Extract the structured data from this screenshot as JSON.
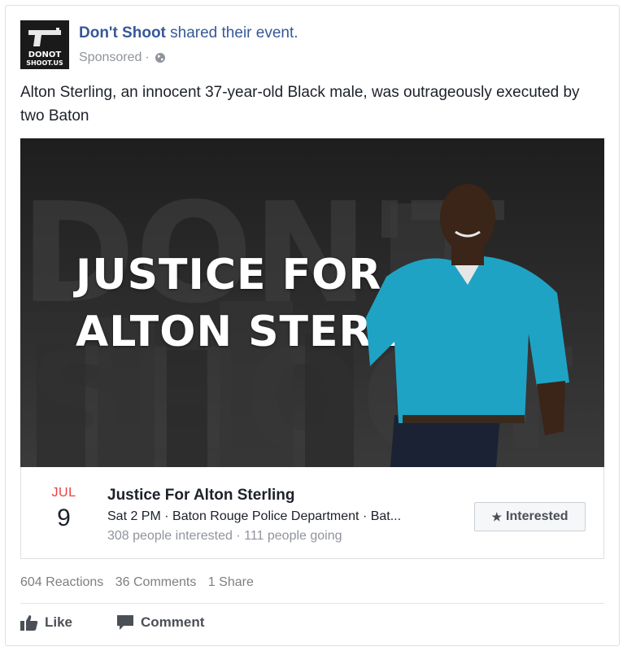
{
  "post": {
    "page_name": "Don't Shoot",
    "shared_text": "shared their event.",
    "sponsored": "Sponsored",
    "dot": "·",
    "avatar_line1": "DONOT",
    "avatar_line2": "SHOOT.US",
    "body": "Alton Sterling, an innocent 37-year-old Black male, was outrageously executed by two Baton"
  },
  "event_image": {
    "line1": "JUSTICE FOR",
    "line2": "ALTON STERLING"
  },
  "event": {
    "month": "JUL",
    "day": "9",
    "title": "Justice For Alton Sterling",
    "details": "Sat 2 PM · Baton Rouge Police Department · Bat...",
    "stats": "308 people interested · 111 people going",
    "interested_label": "Interested"
  },
  "engagement": {
    "reactions": "604 Reactions",
    "comments": "36 Comments",
    "shares": "1 Share"
  },
  "actions": {
    "like": "Like",
    "comment": "Comment"
  },
  "colors": {
    "link_blue": "#365899",
    "month_red": "#e9403f",
    "muted": "#90949c",
    "shirt_teal": "#1fa3c4"
  }
}
